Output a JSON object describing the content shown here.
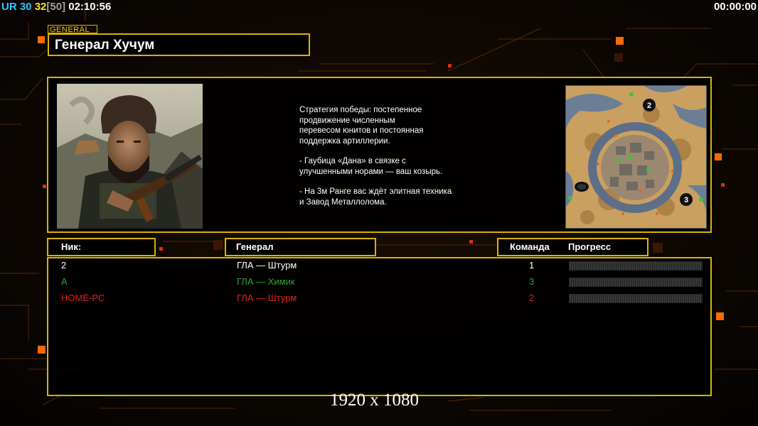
{
  "hud": {
    "prefix": "UR",
    "val1": "30",
    "val2": "32",
    "bracket_val": "[50]",
    "clock": "02:10:56",
    "timer": "00:00:00",
    "colors": {
      "prefix": "#34c8ff",
      "val1": "#38c0ff",
      "val2": "#ffe02a",
      "bracket": "#a0a0a0",
      "clock": "#ffffff"
    }
  },
  "general_tag": "GENERAL",
  "general_name": "Генерал Хучум",
  "description": {
    "p1_lines": [
      "Стратегия победы: постепенное",
      "продвижение численным",
      "перевесом юнитов и постоянная",
      "поддержка артиллерии."
    ],
    "p2_lines": [
      "- Гаубица «Дана» в связке с",
      "улучшенными норами — ваш козырь."
    ],
    "p3_lines": [
      "- На 3м Ранге вас ждёт элитная техника",
      "и Завод Металлолома."
    ]
  },
  "minimap": {
    "spots": [
      "2",
      "3"
    ]
  },
  "table": {
    "headers": {
      "nick": "Ник:",
      "general": "Генерал",
      "team": "Команда",
      "progress": "Прогресс"
    },
    "rows": [
      {
        "nick": "2",
        "general": "ГЛА — Штурм",
        "team": "1",
        "color": "#ffffff",
        "progress": 0
      },
      {
        "nick": "A",
        "general": "ГЛА — Химик",
        "team": "3",
        "color": "#2fa82f",
        "progress": 0
      },
      {
        "nick": "HOME-PC",
        "general": "ГЛА — Штурм",
        "team": "2",
        "color": "#e5201c",
        "progress": 0
      }
    ]
  },
  "resolution_label": "1920 x 1080",
  "theme": {
    "frame": "#d8b300",
    "accent_orange": "#ff6a00"
  }
}
